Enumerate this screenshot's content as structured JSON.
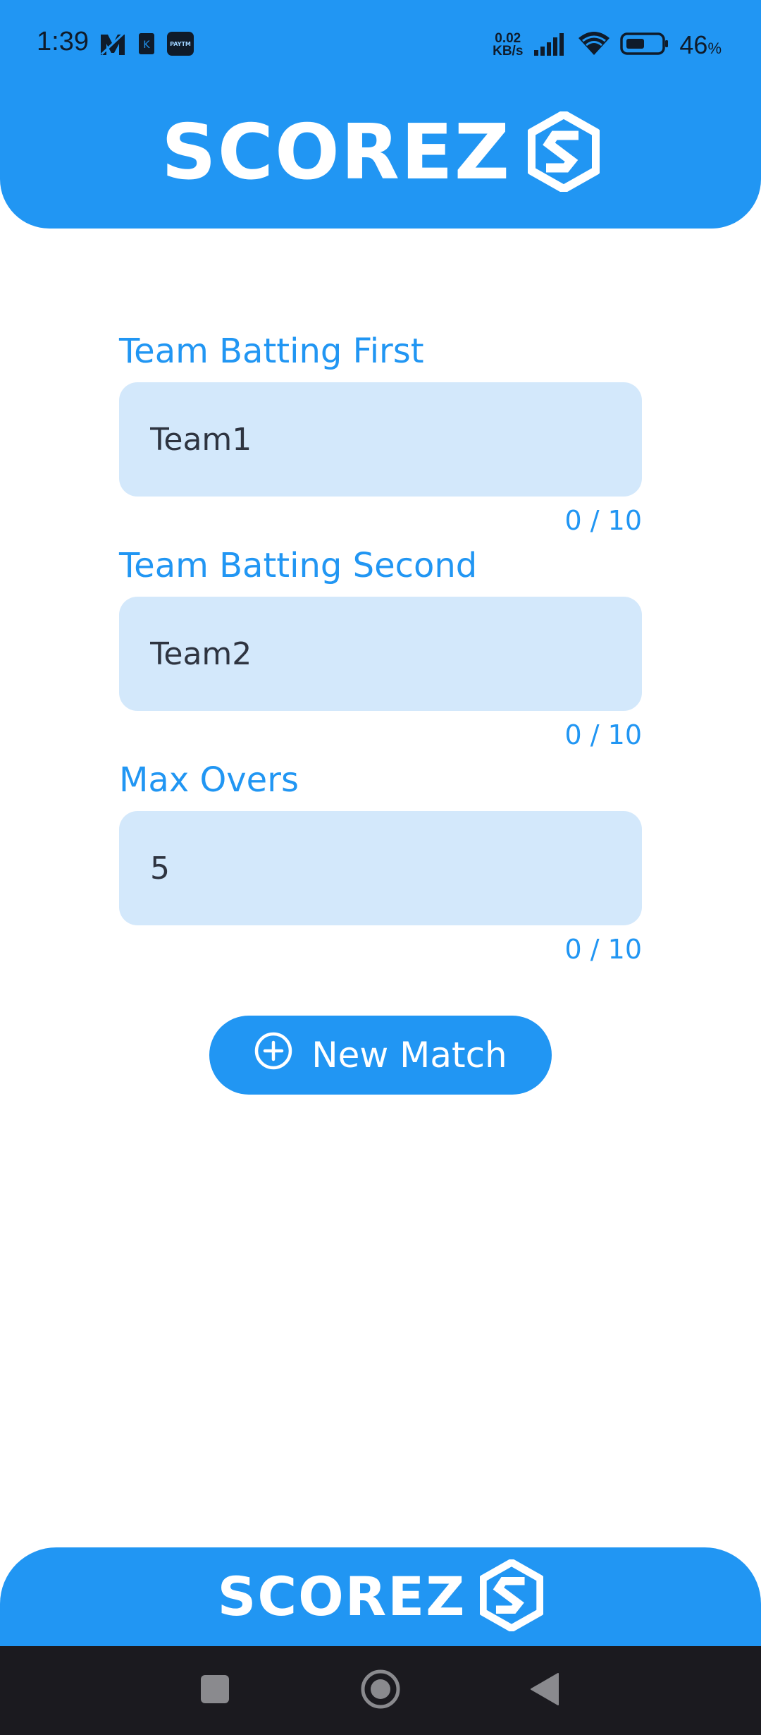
{
  "status_bar": {
    "time": "1:39",
    "net_speed_value": "0.02",
    "net_speed_unit": "KB/s",
    "battery_percent": "46",
    "battery_percent_sign": "%",
    "paytm_text": "PAYTM",
    "k_text": "K",
    "icons": [
      "m-app-icon",
      "k-app-icon",
      "paytm-icon",
      "signal-icon",
      "wifi-icon",
      "battery-icon"
    ]
  },
  "header": {
    "brand": "SCOREZ",
    "logo_icon": "scorez-hexagon-logo"
  },
  "form": {
    "fields": [
      {
        "label": "Team Batting First",
        "value": "Team1",
        "counter": "0 / 10"
      },
      {
        "label": "Team Batting Second",
        "value": "Team2",
        "counter": "0 / 10"
      },
      {
        "label": "Max Overs",
        "value": "5",
        "counter": "0 / 10"
      }
    ],
    "new_match_label": "New Match",
    "new_match_icon": "plus-circle-icon"
  },
  "footer": {
    "brand": "SCOREZ"
  },
  "nav": {
    "items": [
      "recents-square-icon",
      "home-circle-icon",
      "back-triangle-icon"
    ]
  },
  "colors": {
    "primary": "#2196F3",
    "input_bg": "#D3E8FB",
    "nav_bg": "#1b1a1f"
  }
}
